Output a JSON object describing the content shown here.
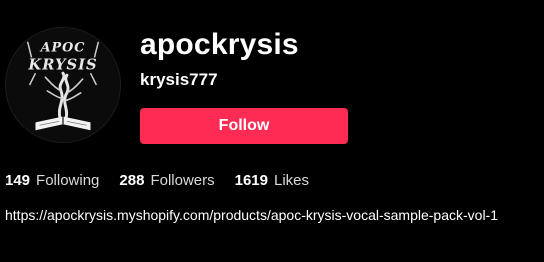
{
  "profile": {
    "display_name": "apockrysis",
    "username": "krysis777",
    "avatar_text": "APOC KRYSIS",
    "follow_label": "Follow",
    "bio_link": "https://apockrysis.myshopify.com/products/apoc-krysis-vocal-sample-pack-vol-1"
  },
  "stats": {
    "following_count": "149",
    "following_label": "Following",
    "followers_count": "288",
    "followers_label": "Followers",
    "likes_count": "1619",
    "likes_label": "Likes"
  },
  "colors": {
    "background": "#000000",
    "accent": "#fe2c55",
    "text": "#ffffff"
  }
}
